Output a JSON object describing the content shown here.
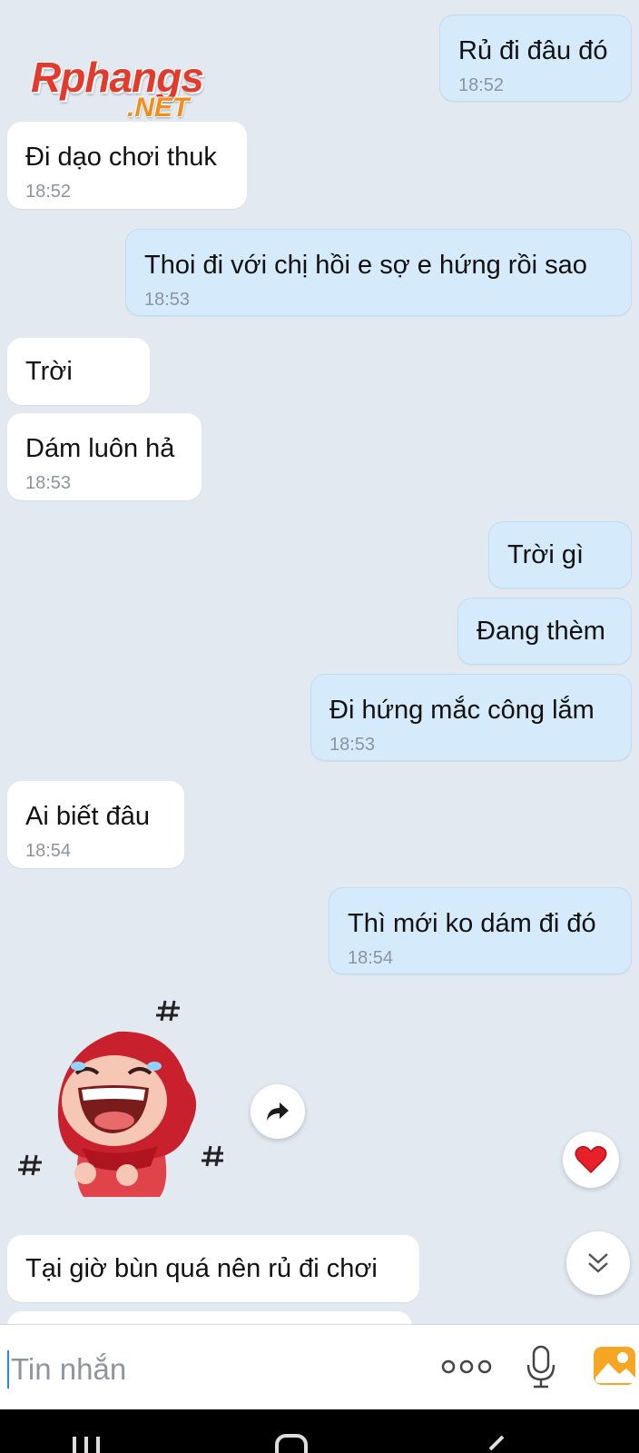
{
  "brand": {
    "name": "Rphangs",
    "suffix": ".NET"
  },
  "messages": [
    {
      "side": "sent",
      "text": "Rủ đi đâu đó",
      "time": "18:52"
    },
    {
      "side": "recv",
      "text": "Đi dạo chơi thuk",
      "time": "18:52"
    },
    {
      "side": "sent",
      "text": "Thoi đi với chị hồi e sợ e hứng rồi sao",
      "time": "18:53"
    },
    {
      "side": "recv",
      "text": "Trời",
      "time": ""
    },
    {
      "side": "recv",
      "text": "Dám luôn hả",
      "time": "18:53"
    },
    {
      "side": "sent",
      "text": "Trời gì",
      "time": ""
    },
    {
      "side": "sent",
      "text": "Đang thèm",
      "time": ""
    },
    {
      "side": "sent",
      "text": "Đi hứng mắc công lắm",
      "time": "18:53"
    },
    {
      "side": "recv",
      "text": "Ai biết đâu",
      "time": "18:54"
    },
    {
      "side": "sent",
      "text": "Thì mới ko dám đi đó",
      "time": "18:54"
    },
    {
      "side": "recv",
      "text": "Tại giờ bùn quá nên rủ đi chơi",
      "time": ""
    }
  ],
  "sticker": {
    "name": "laughing-red-hood-sticker"
  },
  "composer": {
    "placeholder": "Tin nhắn"
  },
  "colors": {
    "background": "#e2e9f1",
    "sent_bubble": "#d5eafb",
    "received_bubble": "#ffffff",
    "accent": "#1a8cff",
    "heart": "#e8202a"
  }
}
